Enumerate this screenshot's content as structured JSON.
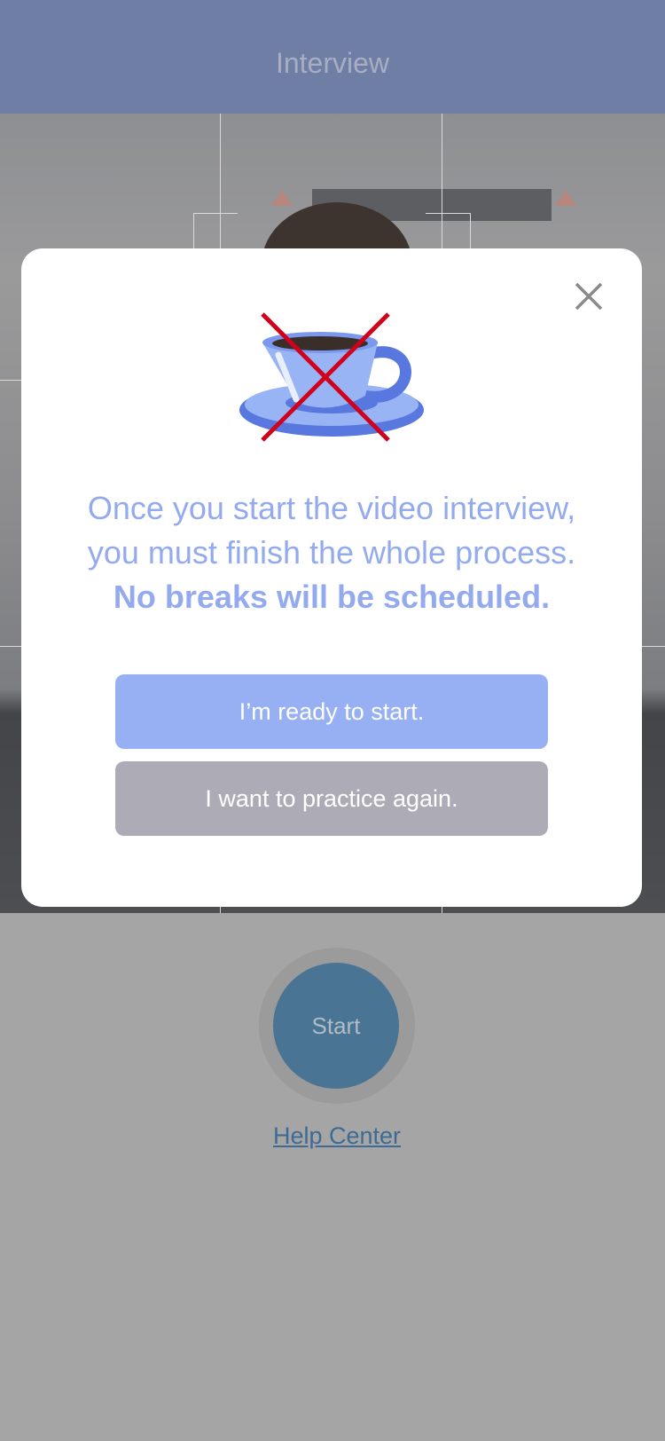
{
  "header": {
    "title": "Interview"
  },
  "modal": {
    "line1": "Once you start the video interview,",
    "line2": "you must finish the whole process.",
    "line3": "No breaks will be scheduled.",
    "ready_label": "I’m ready to start.",
    "practice_label": "I want to practice again."
  },
  "controls": {
    "start_label": "Start",
    "help_label": "Help Center"
  },
  "icons": {
    "close": "close-icon",
    "no_breaks": "no-coffee-break-icon"
  },
  "colors": {
    "header": "#6f7ea4",
    "accent": "#94aaee",
    "ready_button": "#97b0f3",
    "practice_button": "#adacb6",
    "start_button": "#4a7494",
    "cross": "#d0021b"
  }
}
